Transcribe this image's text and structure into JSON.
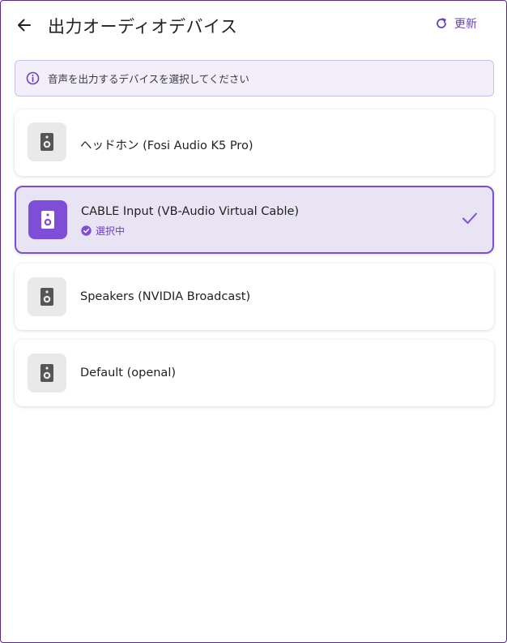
{
  "header": {
    "title": "出力オーディオデバイス",
    "refresh_label": "更新"
  },
  "info": {
    "text": "音声を出力するデバイスを選択してください"
  },
  "devices": [
    {
      "name": "ヘッドホン (Fosi Audio K5 Pro)",
      "selected": false
    },
    {
      "name": "CABLE Input (VB-Audio Virtual Cable)",
      "selected": true,
      "status": "選択中"
    },
    {
      "name": "Speakers (NVIDIA Broadcast)",
      "selected": false
    },
    {
      "name": "Default (openal)",
      "selected": false
    }
  ],
  "colors": {
    "accent": "#7e4fd6",
    "accent_text": "#6b3fc4",
    "selected_bg": "#e9e4f4",
    "info_bg": "#f2effb"
  },
  "icons": {
    "back": "arrow-left-icon",
    "refresh": "refresh-icon",
    "info": "info-icon",
    "device": "speaker-icon",
    "check": "check-icon",
    "status": "check-circle-icon"
  }
}
